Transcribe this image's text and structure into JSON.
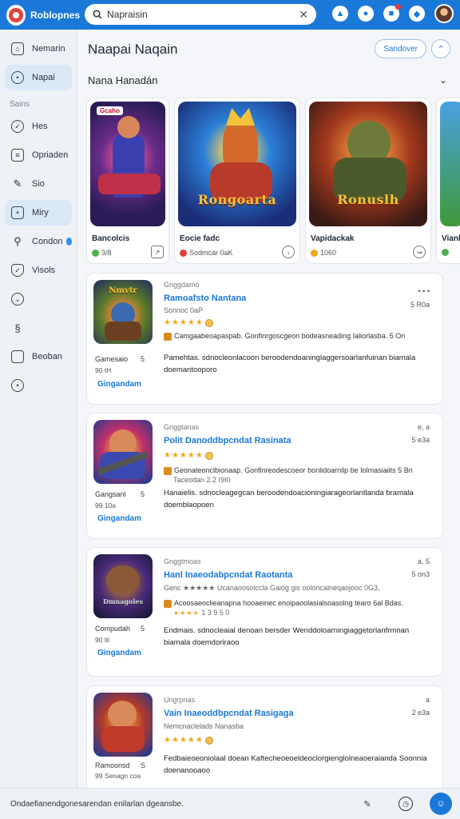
{
  "header": {
    "app_title": "Roblopnes",
    "search": {
      "value": "Napraisin",
      "placeholder": "Search"
    },
    "icons": [
      "notification-icon",
      "account-icon",
      "flag-icon",
      "settings-icon"
    ]
  },
  "sidebar": {
    "items": [
      {
        "label": "Nemarin",
        "icon": "home-icon",
        "active": false
      },
      {
        "label": "Napai",
        "icon": "chat-icon",
        "active": true
      },
      {
        "section": "Sains"
      },
      {
        "label": "Hes",
        "icon": "check-circle-icon",
        "active": false
      },
      {
        "label": "Opriaden",
        "icon": "document-icon",
        "active": false
      },
      {
        "label": "Sio",
        "icon": "pencil-icon",
        "active": false
      },
      {
        "label": "Miry",
        "icon": "grid-icon",
        "active": true
      },
      {
        "label": "Condon",
        "icon": "link-icon",
        "active": false,
        "badge": true
      },
      {
        "label": "Visols",
        "icon": "shield-icon",
        "active": false
      },
      {
        "label": "",
        "icon": "chevron-circle-icon",
        "active": false
      },
      {
        "label": "",
        "icon": "puzzle-icon",
        "active": false
      },
      {
        "label": "Beoban",
        "icon": "square-icon",
        "active": false
      },
      {
        "label": "",
        "icon": "dot-circle-icon",
        "active": false
      }
    ]
  },
  "main": {
    "page_title": "Naapai Naqain",
    "sort_button": "Sandover",
    "section_title": "Nana Hanadán",
    "featured": [
      {
        "name": "Bancolcis",
        "meta": "3/8",
        "art_text": "",
        "tag": "Gcaho",
        "dot_color": "#4caf50"
      },
      {
        "name": "Eocie fadc",
        "meta": "Sodmcar 0aK",
        "art_text": "Rongoarta",
        "tag": "",
        "dot_color": "#e53935"
      },
      {
        "name": "Vapidackak",
        "meta": "1060",
        "art_text": "Ronuslh",
        "tag": "",
        "dot_color": "#f2a516"
      },
      {
        "name": "Vianl",
        "meta": "",
        "art_text": "",
        "tag": "",
        "dot_color": "#4caf50"
      }
    ],
    "list": [
      {
        "thumb_text": "Nmvtr",
        "developer": "Gamesaio",
        "dev_short": "5",
        "dev_sub": "90 tH",
        "get_label": "Gingandam",
        "category": "Gnggdamo",
        "name": "Ramoafsto Nantana",
        "right_top": "• • •",
        "meta": "Sonnoc 0aP",
        "right_meta": "5 R0a",
        "stars": "★★★★★",
        "review": "Camgaabeoapaspab. Gonfinrgoscgeon bodeasneading Ialiorlasba. 5 On",
        "review_sub": "",
        "desc": "Pamehtas. sdnocleonlacoon beroodendoaninglaggersoarlanfuinan biamala doemantooporo"
      },
      {
        "thumb_text": "",
        "developer": "Gangsanl",
        "dev_short": "5",
        "dev_sub": "99 10a",
        "get_label": "Gingandam",
        "category": "Gnggtanas",
        "name": "Polit Danoddbpcndat Rasinata",
        "right_top": "e, a",
        "meta": "",
        "right_meta": "5 e3a",
        "stars": "★★★★★",
        "review": "Geonateonclbionaap. Gonfinreodescoeor bonlidoarnilp be Iolmasiaiits 5 Bn",
        "review_sub": "Taceodan 2.2 I9I0",
        "desc": "Hanaielis. sdnocleagegcan beroodendoacioningiarageorlantlanda bramala doemblaopoen"
      },
      {
        "thumb_text": "Dmnagoles",
        "developer": "Compudah",
        "dev_short": "5",
        "dev_sub": "90 tli",
        "get_label": "Gingandam",
        "category": "Gnggtmoas",
        "name": "Hanl Inaeodabpcndat Raotanta",
        "right_top": "a, 5",
        "meta": "Genc ★★★★★ Ucanaoosolccla Gaiog gis ooloncalneqaojooc 0G3,",
        "right_meta": "5 on3",
        "stars": "★★★★",
        "review": "Acoosaeoclieanapna hooaeinec enoipaoolasialsoasolng tearo 6al Bdas.",
        "review_sub": "1 3 9 5 0",
        "desc": "Endmais. sdnocleaial denoan bersder Wenddoloarningiaggetorlanfrmnan biamala doemdoriraoo"
      },
      {
        "thumb_text": "",
        "developer": "Ramoonsd",
        "dev_short": "S",
        "dev_sub": "99 Senagn coa",
        "get_label": "",
        "category": "Ungrpnas",
        "name": "Vain Inaeoddbpcndat Rasigaga",
        "right_top": "a",
        "meta": "Nemcnaclelads Nanasba",
        "right_meta": "2 e3a",
        "stars": "★★★★★",
        "review": "",
        "review_sub": "",
        "desc": "Fedbaieoeoniolaal doean Kaftecheoeoeldeoclorgieriglolneaoeraianda Soonnia doenanooaoo"
      }
    ]
  },
  "bottom": {
    "text": "Ondaefianendgonesarendan enilarlan dgeansbe.",
    "icons": [
      "pen-icon",
      "clock-icon",
      "profile-icon"
    ]
  }
}
